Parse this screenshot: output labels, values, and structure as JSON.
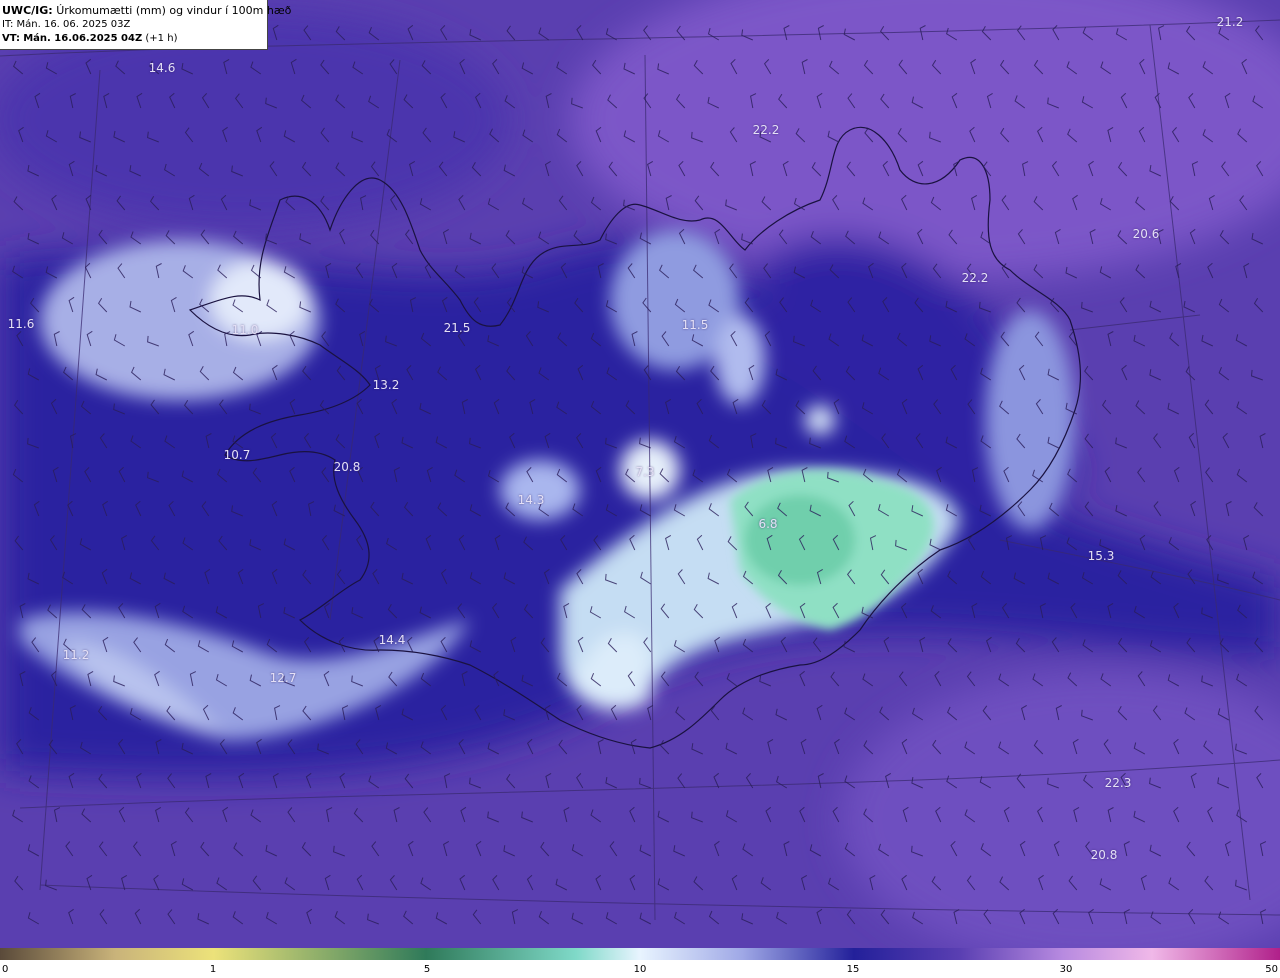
{
  "header": {
    "product": "UWC/IG:",
    "description": "Úrkomumætti (mm) og vindur í 100m hæð",
    "issue_time": "IT: Mán. 16. 06. 2025 03Z",
    "valid_prefix": "VT:",
    "valid_time": "Mán. 16.06.2025 04Z",
    "valid_offset": "(+1 h)"
  },
  "map": {
    "region": "Iceland",
    "field": "precipitable water",
    "overlay": "wind barbs",
    "value_labels": [
      {
        "text": "21.2"
      },
      {
        "text": "14.6"
      },
      {
        "text": "22.2"
      },
      {
        "text": "20.6"
      },
      {
        "text": "22.2"
      },
      {
        "text": "11.6"
      },
      {
        "text": "11.0"
      },
      {
        "text": "21.5"
      },
      {
        "text": "11.5"
      },
      {
        "text": "13.2"
      },
      {
        "text": "10.7"
      },
      {
        "text": "20.8"
      },
      {
        "text": "14.3"
      },
      {
        "text": "7.3"
      },
      {
        "text": "6.8"
      },
      {
        "text": "15.3"
      },
      {
        "text": "14.4"
      },
      {
        "text": "11.2"
      },
      {
        "text": "12.7"
      },
      {
        "text": "22.3"
      },
      {
        "text": "20.8"
      }
    ]
  },
  "colorbar": {
    "ticks": [
      {
        "label": "0",
        "value": 0
      },
      {
        "label": "1",
        "value": 1
      },
      {
        "label": "5",
        "value": 5
      },
      {
        "label": "10",
        "value": 10
      },
      {
        "label": "15",
        "value": 15
      },
      {
        "label": "30",
        "value": 30
      },
      {
        "label": "50",
        "value": 50
      }
    ],
    "colors": [
      "#5a4a3a",
      "#c9b37a",
      "#ece27a",
      "#2f7a5a",
      "#7fd9c8",
      "#e8f4ff",
      "#9fa8e6",
      "#23209a",
      "#5a3fb2",
      "#b78ae0",
      "#f0b8e8",
      "#b0208a"
    ]
  }
}
